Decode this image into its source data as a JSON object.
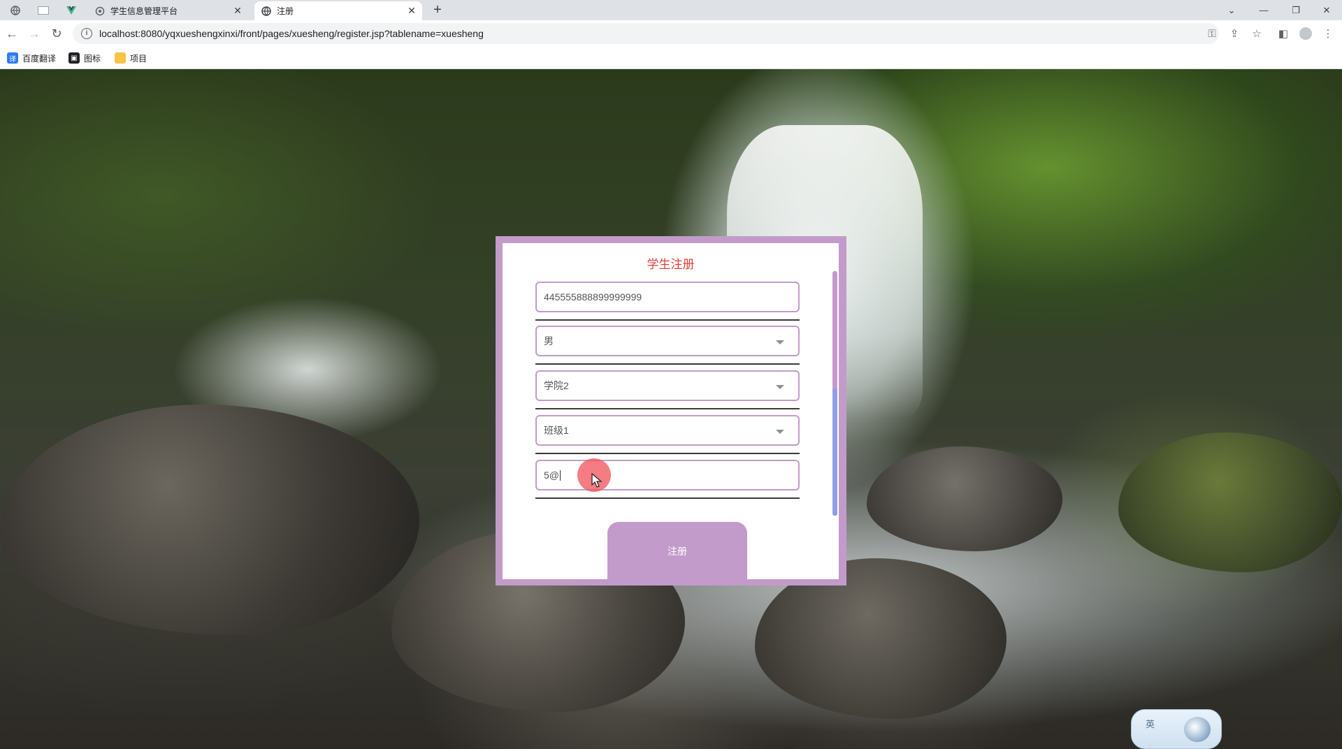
{
  "browser": {
    "tabs": [
      {
        "title": "学生信息管理平台",
        "active": false
      },
      {
        "title": "注册",
        "active": true
      }
    ],
    "new_tab_label": "+",
    "url": "localhost:8080/yqxueshengxinxi/front/pages/xuesheng/register.jsp?tablename=xuesheng",
    "bookmarks": [
      {
        "label": "百度翻译",
        "icon": "translate-icon"
      },
      {
        "label": "图标",
        "icon": "image-icon"
      },
      {
        "label": "项目",
        "icon": "folder-icon"
      }
    ]
  },
  "form": {
    "title": "学生注册",
    "id_value": "445555888899999999",
    "gender_value": "男",
    "college_value": "学院2",
    "class_value": "班级1",
    "email_value": "5@",
    "submit_label": "注册"
  },
  "ime": {
    "label": "英"
  },
  "colors": {
    "panel_border": "#c39bcb",
    "title_red": "#e0403a",
    "scroll_thumb": "#8f9ee6"
  }
}
